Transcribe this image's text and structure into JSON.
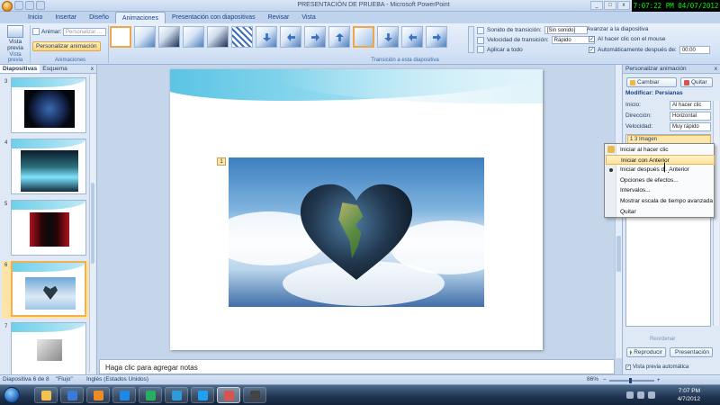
{
  "window": {
    "title": "PRESENTACIÓN DE PRUEBA - Microsoft PowerPoint",
    "clock": "7:07:22 PM 04/07/2012"
  },
  "ribbon_tabs": [
    "Inicio",
    "Insertar",
    "Diseño",
    "Animaciones",
    "Presentación con diapositivas",
    "Revisar",
    "Vista"
  ],
  "ribbon": {
    "preview_label": "Vista previa",
    "preview_group": "Vista previa",
    "animar_label": "Animar:",
    "animar_value": "Personalizar ...",
    "custom_anim_button": "Personalizar animación",
    "anim_group": "Animaciones",
    "transition_group": "Transición a esta diapositiva",
    "sound_label": "Sonido de transición:",
    "sound_value": "[Sin sonido]",
    "speed_label": "Velocidad de transición:",
    "speed_value": "Rápido",
    "apply_all": "Aplicar a todo",
    "advance_title": "Avanzar a la diapositiva",
    "on_click": "Al hacer clic con el mouse",
    "auto_after": "Automáticamente después de:",
    "auto_time": "00:00"
  },
  "left_pane": {
    "tab_slides": "Diapositivas",
    "tab_outline": "Esquema",
    "close": "x",
    "slide_numbers": [
      "3",
      "4",
      "5",
      "6",
      "7"
    ]
  },
  "slide": {
    "anim_tag": "1"
  },
  "notes_placeholder": "Haga clic para agregar notas",
  "custom_pane": {
    "title": "Personalizar animación",
    "close": "x",
    "change_btn": "Cambiar",
    "remove_btn": "Quitar",
    "modify_title": "Modificar: Persianas",
    "start_label": "Inicio:",
    "start_value": "Al hacer clic",
    "direction_label": "Dirección:",
    "direction_value": "Horizontal",
    "speed_label": "Velocidad:",
    "speed_value": "Muy rápido",
    "list_item": "1    3 Imagen",
    "reorder": "Reordenar",
    "play_btn": "Reproducir",
    "show_btn": "Presentación",
    "auto_preview": "Vista previa automática"
  },
  "context_menu": {
    "items": [
      "Iniciar al hacer clic",
      "Iniciar con Anterior",
      "Iniciar después de Anterior",
      "Opciones de efectos...",
      "Intervalos...",
      "Mostrar escala de tiempo avanzada",
      "Quitar"
    ],
    "highlighted_index": 1
  },
  "status_bar": {
    "slide_pos": "Diapositiva 6 de 8",
    "theme": "\"Flujo\"",
    "language": "Inglés (Estados Unidos)",
    "zoom": "86%"
  },
  "taskbar": {
    "time": "7:07 PM",
    "date": "4/7/2012",
    "icon_colors": [
      "#f2c14e",
      "#3a7bd5",
      "#f08a24",
      "#1e88e5",
      "#27ae60",
      "#2d9bd8",
      "#1da1f2",
      "#d9534f",
      "#444444"
    ]
  },
  "colors": {
    "accent_highlight": "#ffe194",
    "ribbon_blue": "#15428b"
  }
}
